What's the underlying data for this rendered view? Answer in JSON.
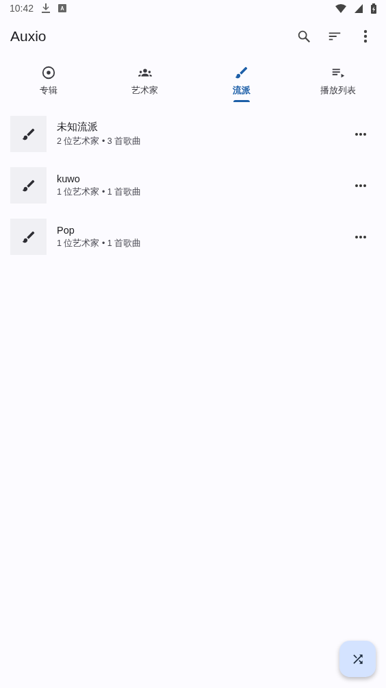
{
  "status_bar": {
    "time": "10:42"
  },
  "app_bar": {
    "title": "Auxio"
  },
  "tabs": [
    {
      "label": "专辑",
      "kind": "album",
      "selected": false
    },
    {
      "label": "艺术家",
      "kind": "artist",
      "selected": false
    },
    {
      "label": "流派",
      "kind": "genre",
      "selected": true
    },
    {
      "label": "播放列表",
      "kind": "playlist",
      "selected": false
    }
  ],
  "genres": [
    {
      "name": "未知流派",
      "details": "2 位艺术家 • 3 首歌曲"
    },
    {
      "name": "kuwo",
      "details": "1 位艺术家 • 1 首歌曲"
    },
    {
      "name": "Pop",
      "details": "1 位艺术家 • 1 首歌曲"
    }
  ]
}
